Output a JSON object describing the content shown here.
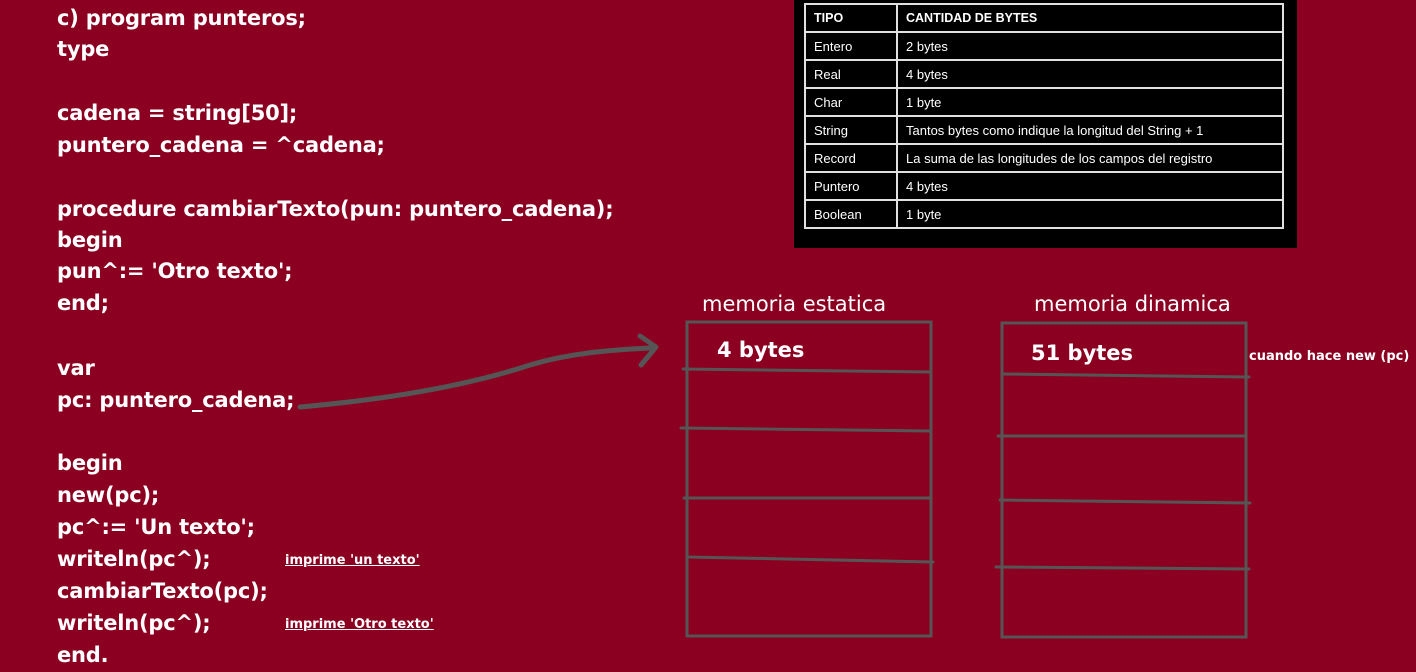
{
  "code": [
    "c) program punteros;",
    "type",
    "",
    "cadena = string[50];",
    "puntero_cadena = ^cadena;",
    "",
    "procedure cambiarTexto(pun: puntero_cadena);",
    "begin",
    "pun^:= 'Otro texto';",
    "end;",
    "",
    "var",
    "pc: puntero_cadena;",
    "",
    "begin",
    "new(pc);",
    "pc^:= 'Un texto';",
    "writeln(pc^);",
    "cambiarTexto(pc);",
    "writeln(pc^);",
    "end."
  ],
  "annotations": {
    "first_writeln": "imprime 'un texto'",
    "second_writeln": "imprime 'Otro texto'"
  },
  "bytes_table": {
    "headers": [
      "TIPO",
      "CANTIDAD DE BYTES"
    ],
    "rows": [
      [
        "Entero",
        "2 bytes"
      ],
      [
        "Real",
        "4 bytes"
      ],
      [
        "Char",
        "1 byte"
      ],
      [
        "String",
        "Tantos bytes como indique la longitud del String + 1"
      ],
      [
        "Record",
        "La suma de las longitudes de los campos del registro"
      ],
      [
        "Puntero",
        "4 bytes"
      ],
      [
        "Boolean",
        "1 byte"
      ]
    ]
  },
  "static_memory": {
    "title": "memoria estatica",
    "first_cell": "4 bytes"
  },
  "dynamic_memory": {
    "title": "memoria dinamica",
    "first_cell": "51 bytes",
    "note": "cuando hace new (pc)"
  },
  "colors": {
    "background": "#8b0020",
    "lines": "#555555",
    "table_bg": "#000000",
    "text": "#ffffff"
  }
}
